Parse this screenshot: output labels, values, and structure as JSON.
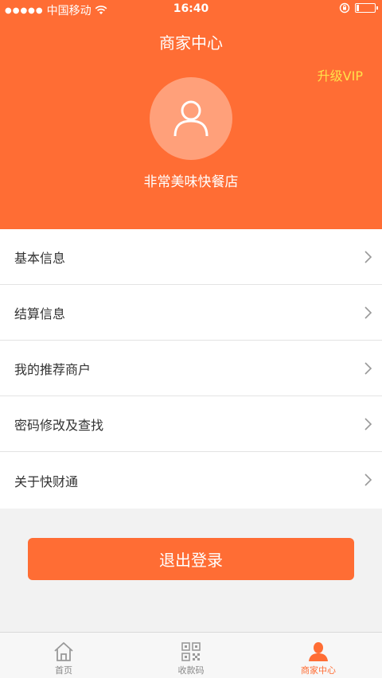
{
  "status_bar": {
    "signal": "●●●●●",
    "carrier": "中国移动",
    "time": "16:40"
  },
  "header": {
    "title": "商家中心",
    "upgrade_label": "升级VIP",
    "shop_name": "非常美味快餐店"
  },
  "menu": {
    "items": [
      {
        "label": "基本信息"
      },
      {
        "label": "结算信息"
      },
      {
        "label": "我的推荐商户"
      },
      {
        "label": "密码修改及查找"
      },
      {
        "label": "关于快财通"
      }
    ]
  },
  "logout_label": "退出登录",
  "tabbar": {
    "tabs": [
      {
        "label": "首页",
        "icon": "home-icon"
      },
      {
        "label": "收款码",
        "icon": "qrcode-icon"
      },
      {
        "label": "商家中心",
        "icon": "user-icon"
      }
    ],
    "active_color": "#ff6d34"
  },
  "colors": {
    "accent": "#ff6d34",
    "vip": "#ffe24a"
  }
}
